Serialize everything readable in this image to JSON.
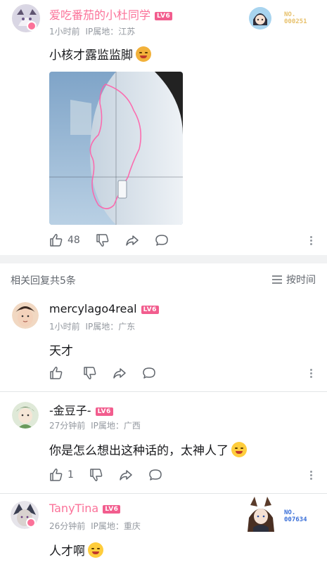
{
  "main_comment": {
    "username": "爱吃番茄的小杜同学",
    "level": "LV6",
    "time": "1小时前",
    "ip_location": "IP属地：江苏",
    "text": "小核才露监监脚",
    "fan_badge_no": "NO.\n000251",
    "like_count": "48"
  },
  "replies_header": {
    "count_text": "相关回复共5条",
    "sort_label": "按时间"
  },
  "replies": [
    {
      "username": "mercylago4real",
      "level": "LV6",
      "time": "1小时前",
      "ip_location": "IP属地：广东",
      "text": "天才",
      "like_count": ""
    },
    {
      "username": "-金豆子-",
      "level": "LV6",
      "time": "27分钟前",
      "ip_location": "IP属地：广西",
      "text": "你是怎么想出这种话的，太神人了",
      "like_count": "1"
    },
    {
      "username": "TanyTina",
      "level": "LV6",
      "time": "26分钟前",
      "ip_location": "IP属地：重庆",
      "text": "人才啊",
      "fan_badge_no": "NO.\n007634"
    }
  ],
  "colors": {
    "vip_pink": "#fb7299",
    "level_red": "#f25d8e",
    "meta_gray": "#9499a0",
    "accent_blue": "#3a6fd8"
  }
}
